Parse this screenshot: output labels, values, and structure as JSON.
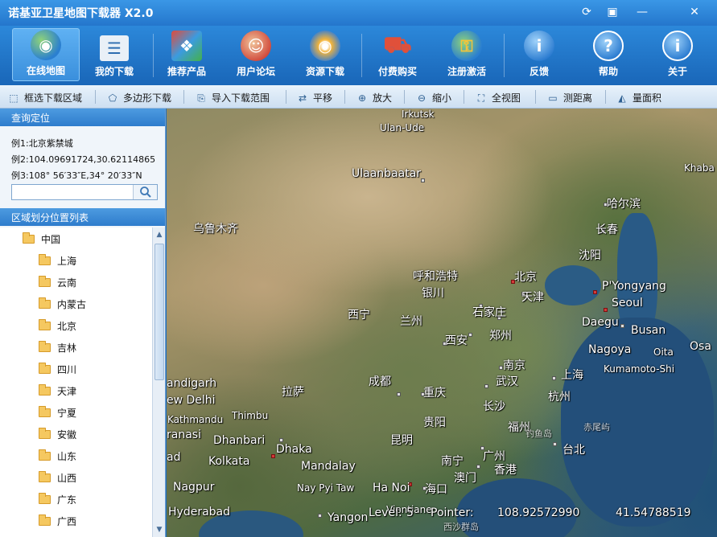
{
  "app": {
    "title": "诺基亚卫星地图下载器 X2.0"
  },
  "window_controls": [
    {
      "name": "update-icon",
      "glyph": "⟳"
    },
    {
      "name": "menu-icon",
      "glyph": "▣"
    },
    {
      "name": "minimize-icon",
      "glyph": "—"
    },
    {
      "name": "close-icon",
      "glyph": "✕"
    }
  ],
  "toolbar": {
    "items": [
      {
        "label": "在线地图",
        "icon": "globe-icon",
        "color": "#2c9a3a",
        "glyph": "◉",
        "active": true
      },
      {
        "label": "我的下载",
        "icon": "download-list-icon",
        "color": "#d9e6f3",
        "glyph": "☰"
      },
      {
        "label": "推荐产品",
        "icon": "cubes-icon",
        "color": "#3b78d8",
        "glyph": "❖"
      },
      {
        "label": "用户论坛",
        "icon": "users-icon",
        "color": "#d84a3a",
        "glyph": "☺"
      },
      {
        "label": "资源下载",
        "icon": "disc-icon",
        "color": "#f0a020",
        "glyph": "◎"
      },
      {
        "label": "付费购买",
        "icon": "cart-icon",
        "color": "#d84030",
        "glyph": "⛟"
      },
      {
        "label": "注册激活",
        "icon": "lock-globe-icon",
        "color": "#c9a030",
        "glyph": "⚿"
      },
      {
        "label": "反馈",
        "icon": "info-bubble-icon",
        "color": "#3a8ee0",
        "glyph": "i"
      },
      {
        "label": "帮助",
        "icon": "help-icon",
        "color": "#3a8ee0",
        "glyph": "?"
      },
      {
        "label": "关于",
        "icon": "about-icon",
        "color": "#3a8ee0",
        "glyph": "i"
      }
    ]
  },
  "maptools": {
    "items": [
      {
        "label": "框选下载区域",
        "icon": "rect-select-icon",
        "glyph": "⬚"
      },
      {
        "label": "多边形下载",
        "icon": "polygon-icon",
        "glyph": "⬠"
      },
      {
        "label": "导入下载范围",
        "icon": "import-icon",
        "glyph": "⎘"
      },
      {
        "label": "平移",
        "icon": "pan-icon",
        "glyph": "⇄"
      },
      {
        "label": "放大",
        "icon": "zoom-in-icon",
        "glyph": "⊕"
      },
      {
        "label": "缩小",
        "icon": "zoom-out-icon",
        "glyph": "⊖"
      },
      {
        "label": "全视图",
        "icon": "full-view-icon",
        "glyph": "⛶"
      },
      {
        "label": "测距离",
        "icon": "ruler-icon",
        "glyph": "▭"
      },
      {
        "label": "量面积",
        "icon": "area-icon",
        "glyph": "◭"
      }
    ]
  },
  "query": {
    "header": "查询定位",
    "examples": [
      "例1:北京紫禁城",
      "例2:104.09691724,30.62114865",
      "例3:108° 56′33″E,34° 20′33″N"
    ],
    "search_value": ""
  },
  "regions": {
    "header": "区域划分位置列表",
    "root": "中国",
    "items": [
      "上海",
      "云南",
      "内蒙古",
      "北京",
      "吉林",
      "四川",
      "天津",
      "宁夏",
      "安徽",
      "山东",
      "山西",
      "广东",
      "广西"
    ]
  },
  "map": {
    "labels": [
      {
        "text": "Irkutsk",
        "cls": "small"
      },
      {
        "text": "Ulan-Ude",
        "cls": "small"
      },
      {
        "text": "Khaba",
        "cls": "small"
      },
      {
        "text": "Ulaanbaatar",
        "cls": ""
      },
      {
        "text": "哈尔滨",
        "cls": ""
      },
      {
        "text": "乌鲁木齐",
        "cls": ""
      },
      {
        "text": "长春",
        "cls": ""
      },
      {
        "text": "沈阳",
        "cls": ""
      },
      {
        "text": "呼和浩特",
        "cls": ""
      },
      {
        "text": "北京",
        "cls": ""
      },
      {
        "text": "银川",
        "cls": ""
      },
      {
        "text": "天津",
        "cls": ""
      },
      {
        "text": "P'Yongyang",
        "cls": ""
      },
      {
        "text": "Seoul",
        "cls": ""
      },
      {
        "text": "西宁",
        "cls": ""
      },
      {
        "text": "兰州",
        "cls": ""
      },
      {
        "text": "石家庄",
        "cls": ""
      },
      {
        "text": "郑州",
        "cls": ""
      },
      {
        "text": "Daegu",
        "cls": ""
      },
      {
        "text": "Busan",
        "cls": ""
      },
      {
        "text": "西安",
        "cls": ""
      },
      {
        "text": "Nagoya",
        "cls": ""
      },
      {
        "text": "Oita",
        "cls": "small"
      },
      {
        "text": "Osa",
        "cls": ""
      },
      {
        "text": "南京",
        "cls": ""
      },
      {
        "text": "Kumamoto-Shi",
        "cls": "small"
      },
      {
        "text": "上海",
        "cls": ""
      },
      {
        "text": "andigarh",
        "cls": ""
      },
      {
        "text": "成都",
        "cls": ""
      },
      {
        "text": "武汉",
        "cls": ""
      },
      {
        "text": "ew Delhi",
        "cls": ""
      },
      {
        "text": "拉萨",
        "cls": ""
      },
      {
        "text": "重庆",
        "cls": ""
      },
      {
        "text": "杭州",
        "cls": ""
      },
      {
        "text": "长沙",
        "cls": ""
      },
      {
        "text": "Kathmandu",
        "cls": "small"
      },
      {
        "text": "Thimbu",
        "cls": "small"
      },
      {
        "text": "贵阳",
        "cls": ""
      },
      {
        "text": "福州",
        "cls": ""
      },
      {
        "text": "ranasi",
        "cls": ""
      },
      {
        "text": "Dhanbari",
        "cls": ""
      },
      {
        "text": "钓鱼岛",
        "cls": "tiny"
      },
      {
        "text": "赤尾屿",
        "cls": "tiny"
      },
      {
        "text": "昆明",
        "cls": ""
      },
      {
        "text": "广州",
        "cls": ""
      },
      {
        "text": "Dhaka",
        "cls": ""
      },
      {
        "text": "台北",
        "cls": ""
      },
      {
        "text": "ad",
        "cls": ""
      },
      {
        "text": "Kolkata",
        "cls": ""
      },
      {
        "text": "南宁",
        "cls": ""
      },
      {
        "text": "香港",
        "cls": ""
      },
      {
        "text": "Mandalay",
        "cls": ""
      },
      {
        "text": "澳门",
        "cls": ""
      },
      {
        "text": "Nagpur",
        "cls": ""
      },
      {
        "text": "Nay Pyi Taw",
        "cls": "small"
      },
      {
        "text": "Ha Noi",
        "cls": ""
      },
      {
        "text": "海口",
        "cls": ""
      },
      {
        "text": "Hyderabad",
        "cls": ""
      },
      {
        "text": "Yangon",
        "cls": ""
      },
      {
        "text": "Vientiane",
        "cls": "small"
      },
      {
        "text": "西沙群岛",
        "cls": "tiny"
      }
    ]
  },
  "status": {
    "level_label": "Level:",
    "level_value": "5",
    "pointer_label": "Pointer:",
    "lon": "108.92572990",
    "lat": "41.54788519"
  }
}
